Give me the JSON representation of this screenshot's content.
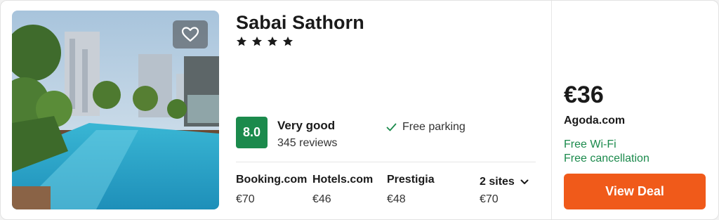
{
  "hotel": {
    "name": "Sabai Sathorn",
    "stars": 4,
    "photo_icon": "hotel-pool-photo",
    "favorite_icon": "heart-icon"
  },
  "rating": {
    "score": "8.0",
    "label": "Very good",
    "reviews": "345 reviews",
    "badge_color": "#1b8a4c"
  },
  "amenities": [
    {
      "icon": "check-icon",
      "label": "Free parking"
    }
  ],
  "providers": [
    {
      "name": "Booking.com",
      "price": "€70"
    },
    {
      "name": "Hotels.com",
      "price": "€46"
    },
    {
      "name": "Prestigia",
      "price": "€48"
    },
    {
      "name": "2 sites",
      "price": "€70",
      "icon": "chevron-down-icon"
    }
  ],
  "best_deal": {
    "price": "€36",
    "provider": "Agoda.com",
    "perks": [
      "Free Wi-Fi",
      "Free cancellation"
    ],
    "button_label": "View Deal",
    "button_color": "#f05a1a",
    "perk_color": "#1b8a4c"
  }
}
